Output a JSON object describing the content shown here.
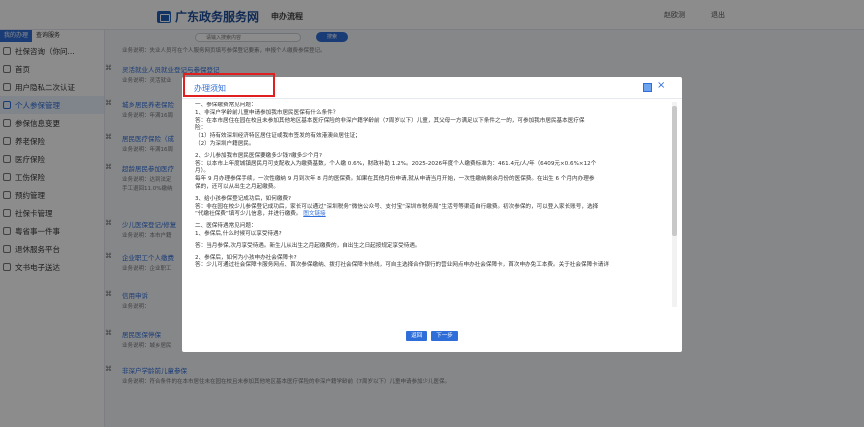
{
  "header": {
    "title": "广东政务服务网",
    "subtitle": "申办流程",
    "user": "赵欧测",
    "logout": "退出",
    "search_placeholder": "请输入搜索内容",
    "search_button": "搜索"
  },
  "sidebar": {
    "tabs": [
      "我的办理",
      "查询服务"
    ],
    "items": [
      "社保咨询（你问...",
      "首页",
      "用户隐私二次认证",
      "个人参保管理",
      "参保信息变更",
      "养老保险",
      "医疗保险",
      "工伤保险",
      "预约管理",
      "社保卡管理",
      "粤省事一件事",
      "退休服务平台",
      "文书电子送达"
    ],
    "active_index": 3
  },
  "list": [
    {
      "desc": "业务说明：失业人员可在个人服务网页填写参保登记要素，申报个人缴费参保登记。"
    },
    {
      "title": "灵活就业人员就业登记与参保登记",
      "desc": "业务说明：灵活就业"
    },
    {
      "title": "城乡居民养老保险",
      "desc": "业务说明：年满16周"
    },
    {
      "title": "居民医疗保险（成",
      "desc": "业务说明：年满16周"
    },
    {
      "title": "超龄居民参加医疗",
      "desc": "业务说明：达到法定",
      "desc2": "手工退回11.0%缴纳"
    },
    {
      "title": "少儿医保登记/修复",
      "desc": "业务说明：本市户籍"
    },
    {
      "title": "企业职工个人缴费",
      "desc": "业务说明：企业职工"
    },
    {
      "title": "信用申诉",
      "desc": "业务说明："
    },
    {
      "title": "居民医保停保",
      "desc": "业务说明：城乡居民"
    },
    {
      "title": "非深户学龄前儿童参保",
      "desc": "业务说明：符合条件的在本市居住未在园在校且未参加其他地区基本医疗保险的非深户籍学龄前（7周岁以下）儿童申请参加少儿医保。"
    }
  ],
  "modal": {
    "title": "办理须知",
    "lines": [
      "一、参保缴费常见问题：",
      "1、非深户学龄前儿童申请参加我市居民医保有什么条件？",
      "答：在本市居住在园在校且未参加其他地区基本医疗保险的非深户籍学龄前（7周岁以下）儿童，其父母一方满足以下条件之一的，可参加我市居民基本医疗保",
      "险：",
      "（1）持有效深圳经济特区居住证或我市签发的有效港澳台居住证；",
      "（2）为深圳户籍居民。",
      "2、少儿参加我市居民医保要缴多少钱?缴多少个月?",
      "答：以本市上年度城镇居民月可支配收入为缴费基数，个人缴 0.6%，财政补助 1.2%。2025-2026年度个人缴费标准为：461.4元/人/年（6409元×0.6%×12个",
      "月）。",
      "每年 9 月办理参保手续，一次性缴纳 9 月到次年 8 月的医保费。如果在其他月份申请,就从申请当月开始，一次性缴纳剩余月份的医保费。在出生 6 个月内办理参",
      "保的，还可以从出生之月起缴费。",
      "3、给小孩参保登记成功后，如何缴费?",
      "答：非在园在校少儿参保登记成功后，家长可以通过“深圳税务”微信公众号、支付宝“深圳市税务局”生活号等渠道自行缴费。初次参保的，可以登入家长账号，选择",
      "“代缴社保费”填写少儿信息，并进行缴费。",
      "二、医保待遇常见问题：",
      "1、参保后,什么时候可以享受待遇?",
      "答：当月参保,次月享受待遇。新生儿从出生之月起缴费的，自出生之日起按规定享受待遇。",
      "2、参保后，如何为小孩申办社会保障卡?",
      "答：少儿可通过社会保障卡服务网点、首次参保缴纳、拨打社会保障卡热线，可自主选择合作银行的营业网点申办社会保障卡，首次申办免工本费。关于社会保障卡请详"
    ],
    "link": "图文链接",
    "buttons": [
      "返回",
      "下一步"
    ]
  }
}
